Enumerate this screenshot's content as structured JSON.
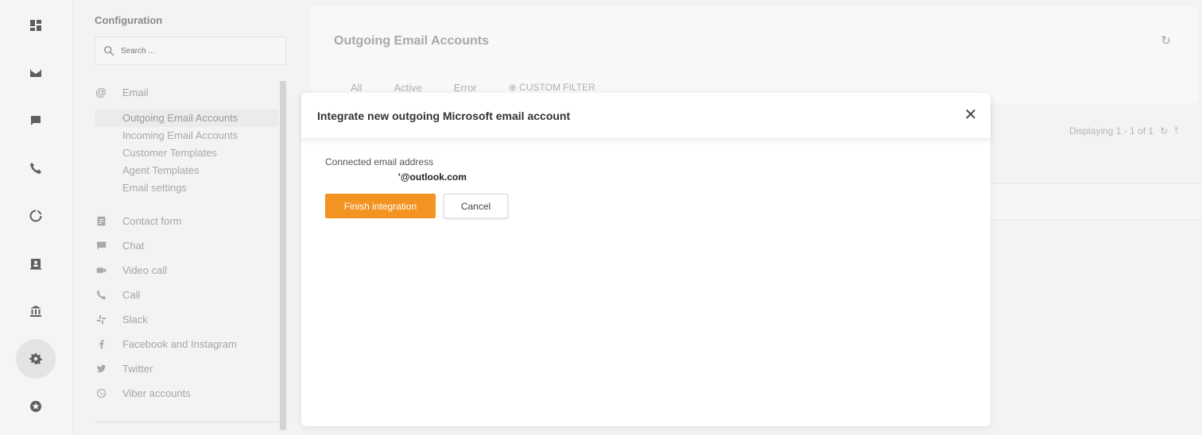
{
  "config": {
    "title": "Configuration",
    "search_placeholder": "Search ...",
    "sections": {
      "email": "Email",
      "contact_form": "Contact form",
      "chat": "Chat",
      "video_call": "Video call",
      "call": "Call",
      "slack": "Slack",
      "facebook": "Facebook and Instagram",
      "twitter": "Twitter",
      "viber": "Viber accounts"
    },
    "email_items": [
      "Outgoing Email Accounts",
      "Incoming Email Accounts",
      "Customer Templates",
      "Agent Templates",
      "Email settings"
    ]
  },
  "main": {
    "title": "Outgoing Email Accounts",
    "filters": [
      "All",
      "Active",
      "Error",
      "CUSTOM FILTER"
    ],
    "displaying": "Displaying 1 - 1 of 1"
  },
  "modal": {
    "title": "Integrate new outgoing Microsoft email account",
    "field_label": "Connected email address",
    "field_value": "'@outlook.com",
    "finish_label": "Finish integration",
    "cancel_label": "Cancel"
  },
  "icons": {
    "rail": [
      "dashboard-icon",
      "mail-icon",
      "chat-icon",
      "phone-icon",
      "circle-icon",
      "contacts-icon",
      "bank-icon",
      "gear-icon",
      "star-icon"
    ]
  },
  "colors": {
    "accent": "#f39322"
  }
}
